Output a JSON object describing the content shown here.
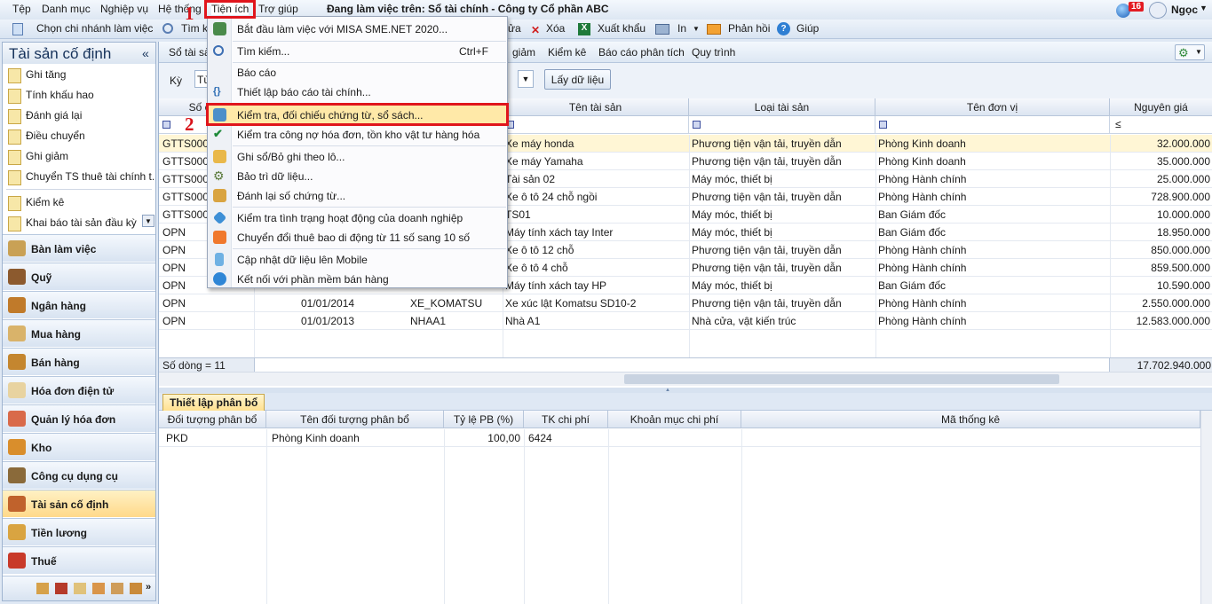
{
  "menubar": {
    "items": [
      "Tệp",
      "Danh mục",
      "Nghiệp vụ",
      "Hệ thống",
      "Tiện ích",
      "Trợ giúp"
    ],
    "title": "Đang làm việc trên: Sổ tài chính - Công ty Cổ phần ABC",
    "badge": "16",
    "user": "Ngọc"
  },
  "toolbar": {
    "branch": "Chọn chi nhánh làm việc",
    "search": "Tìm k",
    "ua": "ửa",
    "delete": "Xóa",
    "export": "Xuất khẩu",
    "print": "In",
    "feedback": "Phản hồi",
    "help": "Giúp"
  },
  "left": {
    "title": "Tài sản cố định",
    "collapse": "«",
    "links": [
      "Ghi tăng",
      "Tính khấu hao",
      "Đánh giá lại",
      "Điều chuyển",
      "Ghi giảm",
      "Chuyển TS thuê tài chính t...",
      "Kiểm kê",
      "Khai báo tài sản đầu kỳ"
    ],
    "modules": [
      "Bàn làm việc",
      "Quỹ",
      "Ngân hàng",
      "Mua hàng",
      "Bán hàng",
      "Hóa đơn điện tử",
      "Quản lý hóa đơn",
      "Kho",
      "Công cụ dụng cụ",
      "Tài sản cố định",
      "Tiền lương",
      "Thuế"
    ],
    "selected_module": "Tài sản cố định",
    "more": "»"
  },
  "main": {
    "subtabs": [
      "Sổ tài sả",
      "giảm",
      "Kiểm kê",
      "Báo cáo phân tích",
      "Quy trình"
    ],
    "filter_label": "Kỳ",
    "filter_value": "Tù",
    "get_data": "Lấy dữ liệu",
    "columns": [
      "Số chứ",
      "Tên tài sản",
      "Loại tài sản",
      "Tên đơn vị",
      "Nguyên giá"
    ],
    "filter_op": "≤",
    "rows": [
      {
        "doc": "GTTS000",
        "date": "",
        "code": "",
        "name": "Xe máy honda",
        "type": "Phương tiện vận tải, truyền dẫn",
        "unit": "Phòng Kinh doanh",
        "value": "32.000.000"
      },
      {
        "doc": "GTTS000",
        "date": "",
        "code": "",
        "name": "Xe máy Yamaha",
        "type": "Phương tiện vận tải, truyền dẫn",
        "unit": "Phòng Kinh doanh",
        "value": "35.000.000"
      },
      {
        "doc": "GTTS000",
        "date": "",
        "code": "",
        "name": "Tài sản 02",
        "type": "Máy móc, thiết bị",
        "unit": "Phòng Hành chính",
        "value": "25.000.000"
      },
      {
        "doc": "GTTS000",
        "date": "",
        "code": "",
        "name": "Xe ô tô 24 chỗ ngồi",
        "type": "Phương tiện vận tải, truyền dẫn",
        "unit": "Phòng Hành chính",
        "value": "728.900.000"
      },
      {
        "doc": "GTTS000",
        "date": "",
        "code": "",
        "name": "TS01",
        "type": "Máy móc, thiết bị",
        "unit": "Ban Giám đốc",
        "value": "10.000.000"
      },
      {
        "doc": "OPN",
        "date": "",
        "code": "",
        "name": "Máy tính xách tay Inter",
        "type": "Máy móc, thiết bị",
        "unit": "Ban Giám đốc",
        "value": "18.950.000"
      },
      {
        "doc": "OPN",
        "date": "",
        "code": "",
        "name": "Xe ô tô 12 chỗ",
        "type": "Phương tiện vận tải, truyền dẫn",
        "unit": "Phòng Hành chính",
        "value": "850.000.000"
      },
      {
        "doc": "OPN",
        "date": "",
        "code": "",
        "name": "Xe ô tô 4 chỗ",
        "type": "Phương tiện vận tải, truyền dẫn",
        "unit": "Phòng Hành chính",
        "value": "859.500.000"
      },
      {
        "doc": "OPN",
        "date": "",
        "code": "",
        "name": "Máy tính xách tay HP",
        "type": "Máy móc, thiết bị",
        "unit": "Ban Giám đốc",
        "value": "10.590.000"
      },
      {
        "doc": "OPN",
        "date": "01/01/2014",
        "code": "XE_KOMATSU",
        "name": "Xe xúc lật Komatsu SD10-2",
        "type": "Phương tiện vận tải, truyền dẫn",
        "unit": "Phòng Hành chính",
        "value": "2.550.000.000"
      },
      {
        "doc": "OPN",
        "date": "01/01/2013",
        "code": "NHAA1",
        "name": "Nhà A1",
        "type": "Nhà cửa, vật kiến trúc",
        "unit": "Phòng Hành chính",
        "value": "12.583.000.000"
      }
    ],
    "row_count": "Số dòng = 11",
    "total": "17.702.940.000"
  },
  "detail": {
    "tab": "Thiết lập phân bổ",
    "columns": [
      "Đối tượng phân bổ",
      "Tên đối tượng phân bổ",
      "Tỷ lệ PB (%)",
      "TK chi phí",
      "Khoản mục chi phí",
      "Mã thống kê"
    ],
    "row": {
      "obj": "PKD",
      "name": "Phòng Kinh doanh",
      "rate": "100,00",
      "acct": "6424",
      "item": "",
      "stat": ""
    }
  },
  "dropdown": {
    "items": [
      {
        "label": "Bắt đầu làm việc với MISA SME.NET 2020...",
        "shortcut": ""
      },
      {
        "label": "Tìm kiếm...",
        "shortcut": "Ctrl+F"
      },
      {
        "label": "Báo cáo",
        "shortcut": ""
      },
      {
        "label": "Thiết lập báo cáo tài chính...",
        "shortcut": ""
      },
      {
        "label": "Kiểm tra, đối chiếu chứng từ, sổ sách...",
        "shortcut": ""
      },
      {
        "label": "Kiểm tra công nợ hóa đơn, tồn kho vật tư hàng hóa",
        "shortcut": ""
      },
      {
        "label": "Ghi sổ/Bỏ ghi theo lô...",
        "shortcut": ""
      },
      {
        "label": "Bảo trì dữ liệu...",
        "shortcut": ""
      },
      {
        "label": "Đánh lại số chứng từ...",
        "shortcut": ""
      },
      {
        "label": "Kiểm tra tình trạng hoạt động của doanh nghiệp",
        "shortcut": ""
      },
      {
        "label": "Chuyển đổi thuê bao di động từ 11 số sang 10 số",
        "shortcut": ""
      },
      {
        "label": "Cập nhật dữ liệu lên Mobile",
        "shortcut": ""
      },
      {
        "label": "Kết nối với phần mềm bán hàng",
        "shortcut": ""
      }
    ]
  },
  "annotations": {
    "step1": "1",
    "step2": "2"
  },
  "colors": {
    "highlight_red": "#e0151c",
    "selected_row": "#fff6d5",
    "menu_hover": "#ffe9a8"
  }
}
